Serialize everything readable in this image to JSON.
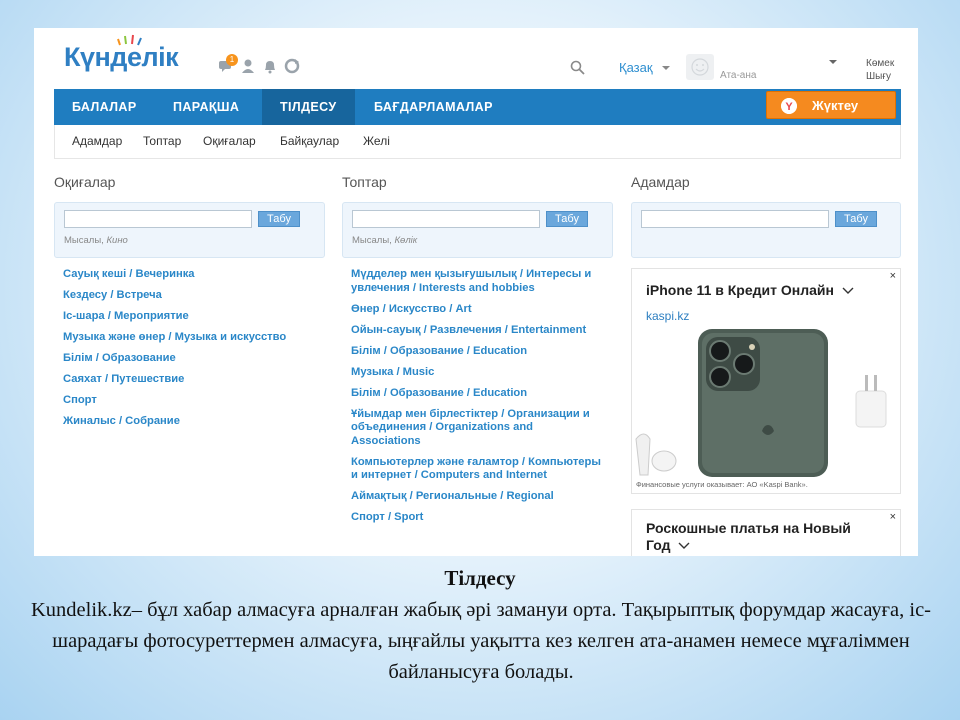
{
  "header": {
    "logo_text": "Күнделік",
    "notification_count": "1",
    "language": "Қазақ",
    "user_role": "Ата-ана",
    "help_label": "Көмек",
    "logout_label": "Шығу"
  },
  "nav": {
    "items": [
      "БАЛАЛАР",
      "ПАРАҚША",
      "ТІЛДЕСУ",
      "БАҒДАРЛАМАЛАР"
    ],
    "active": "ТІЛДЕСУ",
    "upload_label": "Жүктеу"
  },
  "subnav": {
    "items": [
      "Адамдар",
      "Топтар",
      "Оқиғалар",
      "Байқаулар",
      "Желі"
    ]
  },
  "events": {
    "title": "Оқиғалар",
    "search_button": "Табу",
    "hint_prefix": "Мысалы, ",
    "hint_example": "Кино",
    "links": [
      "Сауық кеші / Вечеринка",
      "Кездесу / Встреча",
      "Іс-шара / Мероприятие",
      "Музыка және өнер / Музыка и искусство",
      "Білім / Образование",
      "Саяхат / Путешествие",
      "Спорт",
      "Жиналыс / Собрание"
    ]
  },
  "groups": {
    "title": "Топтар",
    "search_button": "Табу",
    "hint_prefix": "Мысалы, ",
    "hint_example": "Көлік",
    "links": [
      "Мүдделер мен қызығушылық / Интересы и увлечения / Interests and hobbies",
      "Өнер / Искусство / Art",
      "Ойын-сауық / Развлечения / Entertainment",
      "Білім / Образование / Education",
      "Музыка / Music",
      "Білім / Образование / Education",
      "Ұйымдар мен бірлестіктер / Организации и объединения / Organizations and Associations",
      "Компьютерлер және ғаламтор / Компьютеры и интернет / Computers and Internet",
      "Аймақтық / Региональные / Regional",
      "Спорт / Sport"
    ]
  },
  "people": {
    "title": "Адамдар",
    "search_button": "Табу"
  },
  "ad1": {
    "title": "iPhone 11 в Кредит Онлайн",
    "link": "kaspi.kz",
    "footer": "Финансовые услуги оказывает: АО «Kaspi Bank».",
    "close": "×"
  },
  "ad2": {
    "title_line1": "Роскошные платья на Новый",
    "title_line2": "Год",
    "close": "×"
  },
  "caption": {
    "title": "Тілдесу",
    "text": "Kundelik.kz– бұл хабар алмасуға арналған жабық әрі замануи орта. Тақырыптық форумдар жасауға, іс-шарадағы фотосуреттермен алмасуға, ыңғайлы уақытта кез келген ата-анамен немесе мұғаліммен байланысуға болады."
  },
  "colors": {
    "brand_blue": "#1f7dc0",
    "nav_active": "#17659d",
    "upload_orange": "#f58a1f",
    "link_blue": "#2a87c8"
  }
}
